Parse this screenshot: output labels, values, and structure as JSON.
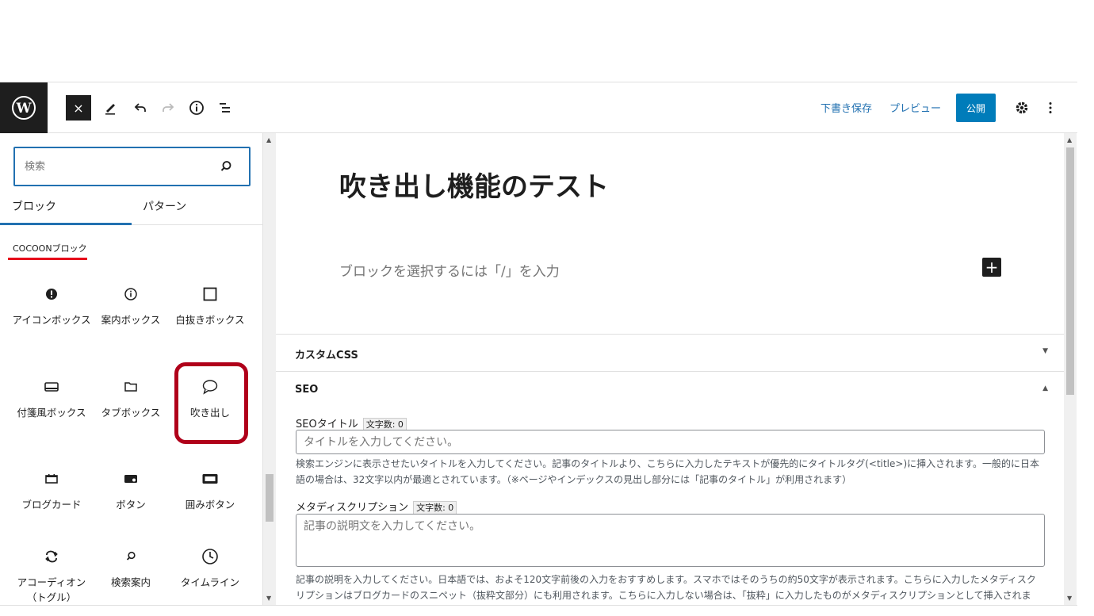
{
  "toolbar": {
    "close_label": "×",
    "save_draft": "下書き保存",
    "preview": "プレビュー",
    "publish": "公開"
  },
  "inserter": {
    "search_placeholder": "検索",
    "tabs": [
      {
        "label": "ブロック",
        "active": true
      },
      {
        "label": "パターン",
        "active": false
      }
    ],
    "category": "COCOONブロック",
    "blocks": [
      {
        "label": "アイコンボックス",
        "icon": "exclamation-circle-icon"
      },
      {
        "label": "案内ボックス",
        "icon": "info-icon"
      },
      {
        "label": "白抜きボックス",
        "icon": "square-icon"
      },
      {
        "label": "付箋風ボックス",
        "icon": "sticky-note-icon"
      },
      {
        "label": "タブボックス",
        "icon": "folder-icon"
      },
      {
        "label": "吹き出し",
        "icon": "speech-bubble-icon",
        "highlighted": true
      },
      {
        "label": "ブログカード",
        "icon": "card-icon"
      },
      {
        "label": "ボタン",
        "icon": "button-icon"
      },
      {
        "label": "囲みボタン",
        "icon": "framed-button-icon"
      },
      {
        "label": "アコーディオン（トグル）",
        "icon": "toggle-icon"
      },
      {
        "label": "検索案内",
        "icon": "search-icon"
      },
      {
        "label": "タイムライン",
        "icon": "clock-icon"
      }
    ]
  },
  "editor": {
    "post_title": "吹き出し機能のテスト",
    "block_placeholder": "ブロックを選択するには「/」を入力",
    "custom_css_title": "カスタムCSS",
    "seo": {
      "title": "SEO",
      "seo_title_label": "SEOタイトル",
      "seo_title_count": "文字数: 0",
      "seo_title_placeholder": "タイトルを入力してください。",
      "seo_title_help": "検索エンジンに表示させたいタイトルを入力してください。記事のタイトルより、こちらに入力したテキストが優先的にタイトルタグ(<title>)に挿入されます。一般的に日本語の場合は、32文字以内が最適とされています。（※ページやインデックスの見出し部分には「記事のタイトル」が利用されます）",
      "meta_desc_label": "メタディスクリプション",
      "meta_desc_count": "文字数: 0",
      "meta_desc_placeholder": "記事の説明文を入力してください。",
      "meta_desc_help": "記事の説明を入力してください。日本語では、およそ120文字前後の入力をおすすめします。スマホではそのうちの約50文字が表示されます。こちらに入力したメタディスクリプションはブログカードのスニペット（抜粋文部分）にも利用されます。こちらに入力しない場合は、「抜粋」に入力したものがメタディスクリプションとして挿入されます。"
    }
  }
}
